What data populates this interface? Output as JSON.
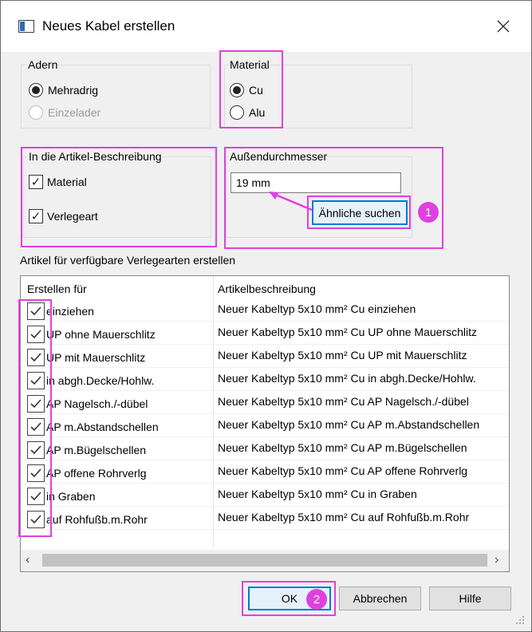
{
  "dialog": {
    "title": "Neues Kabel erstellen"
  },
  "adern": {
    "title": "Adern",
    "options": [
      {
        "label": "Mehradrig",
        "checked": true,
        "disabled": false
      },
      {
        "label": "Einzelader",
        "checked": false,
        "disabled": true
      }
    ]
  },
  "material": {
    "title": "Material",
    "options": [
      {
        "label": "Cu",
        "checked": true
      },
      {
        "label": "Alu",
        "checked": false
      }
    ]
  },
  "artikel_beschreibung": {
    "title": "In die Artikel-Beschreibung",
    "items": [
      {
        "label": "Material",
        "checked": true
      },
      {
        "label": "Verlegeart",
        "checked": true
      }
    ]
  },
  "aussendurchmesser": {
    "title": "Außendurchmesser",
    "value": "19 mm",
    "similar_button": "Ähnliche suchen"
  },
  "table": {
    "section_label": "Artikel für verfügbare Verlegearten erstellen",
    "headers": [
      "Erstellen für",
      "Artikelbeschreibung"
    ],
    "rows": [
      {
        "erstellen": "einziehen",
        "beschreibung": "Neuer Kabeltyp 5x10 mm² Cu einziehen",
        "checked": true
      },
      {
        "erstellen": "UP ohne Mauerschlitz",
        "beschreibung": "Neuer Kabeltyp 5x10 mm² Cu UP ohne Mauerschlitz",
        "checked": true
      },
      {
        "erstellen": "UP mit Mauerschlitz",
        "beschreibung": "Neuer Kabeltyp 5x10 mm² Cu UP mit Mauerschlitz",
        "checked": true
      },
      {
        "erstellen": "in abgh.Decke/Hohlw.",
        "beschreibung": "Neuer Kabeltyp 5x10 mm² Cu in abgh.Decke/Hohlw.",
        "checked": true
      },
      {
        "erstellen": "AP Nagelsch./-dübel",
        "beschreibung": "Neuer Kabeltyp 5x10 mm² Cu AP Nagelsch./-dübel",
        "checked": true
      },
      {
        "erstellen": "AP m.Abstandschellen",
        "beschreibung": "Neuer Kabeltyp 5x10 mm² Cu AP m.Abstandschellen",
        "checked": true
      },
      {
        "erstellen": "AP m.Bügelschellen",
        "beschreibung": "Neuer Kabeltyp 5x10 mm² Cu AP m.Bügelschellen",
        "checked": true
      },
      {
        "erstellen": "AP offene Rohrverlg",
        "beschreibung": "Neuer Kabeltyp 5x10 mm² Cu AP offene Rohrverlg",
        "checked": true
      },
      {
        "erstellen": "in Graben",
        "beschreibung": "Neuer Kabeltyp 5x10 mm² Cu in Graben",
        "checked": true
      },
      {
        "erstellen": "auf Rohfußb.m.Rohr",
        "beschreibung": "Neuer Kabeltyp 5x10 mm² Cu auf Rohfußb.m.Rohr",
        "checked": true
      }
    ]
  },
  "buttons": {
    "ok": "OK",
    "cancel": "Abbrechen",
    "help": "Hilfe"
  },
  "annotations": {
    "badge1": "1",
    "badge2": "2",
    "highlight_color": "#e040e0"
  },
  "icons": {
    "close": "close-icon",
    "check": "check-icon",
    "window": "window-icon"
  }
}
